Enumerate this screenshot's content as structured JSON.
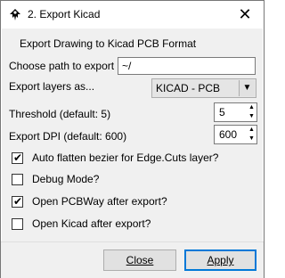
{
  "window": {
    "title": "2. Export Kicad",
    "close_symbol": "✕"
  },
  "form": {
    "heading": "Export Drawing to Kicad PCB Format",
    "path_label": "Choose path to export",
    "path_value": "~/",
    "layers_label": "Export layers as...",
    "layers_selected": "KICAD - PCB",
    "threshold_label": "Threshold (default: 5)",
    "threshold_value": "5",
    "dpi_label": "Export DPI (default: 600)",
    "dpi_value": "600"
  },
  "checkboxes": [
    {
      "label": "Auto flatten bezier for Edge.Cuts layer?",
      "checked": true
    },
    {
      "label": "Debug Mode?",
      "checked": false
    },
    {
      "label": "Open PCBWay after export?",
      "checked": true
    },
    {
      "label": "Open Kicad after export?",
      "checked": false
    }
  ],
  "buttons": {
    "close_label": "Close",
    "apply_label": "Apply"
  },
  "icons": {
    "app": "inkscape-icon",
    "close": "close-icon",
    "dropdown": "chevron-down-icon",
    "spin_up": "spin-up-icon",
    "spin_down": "spin-down-icon",
    "check": "check-icon"
  }
}
